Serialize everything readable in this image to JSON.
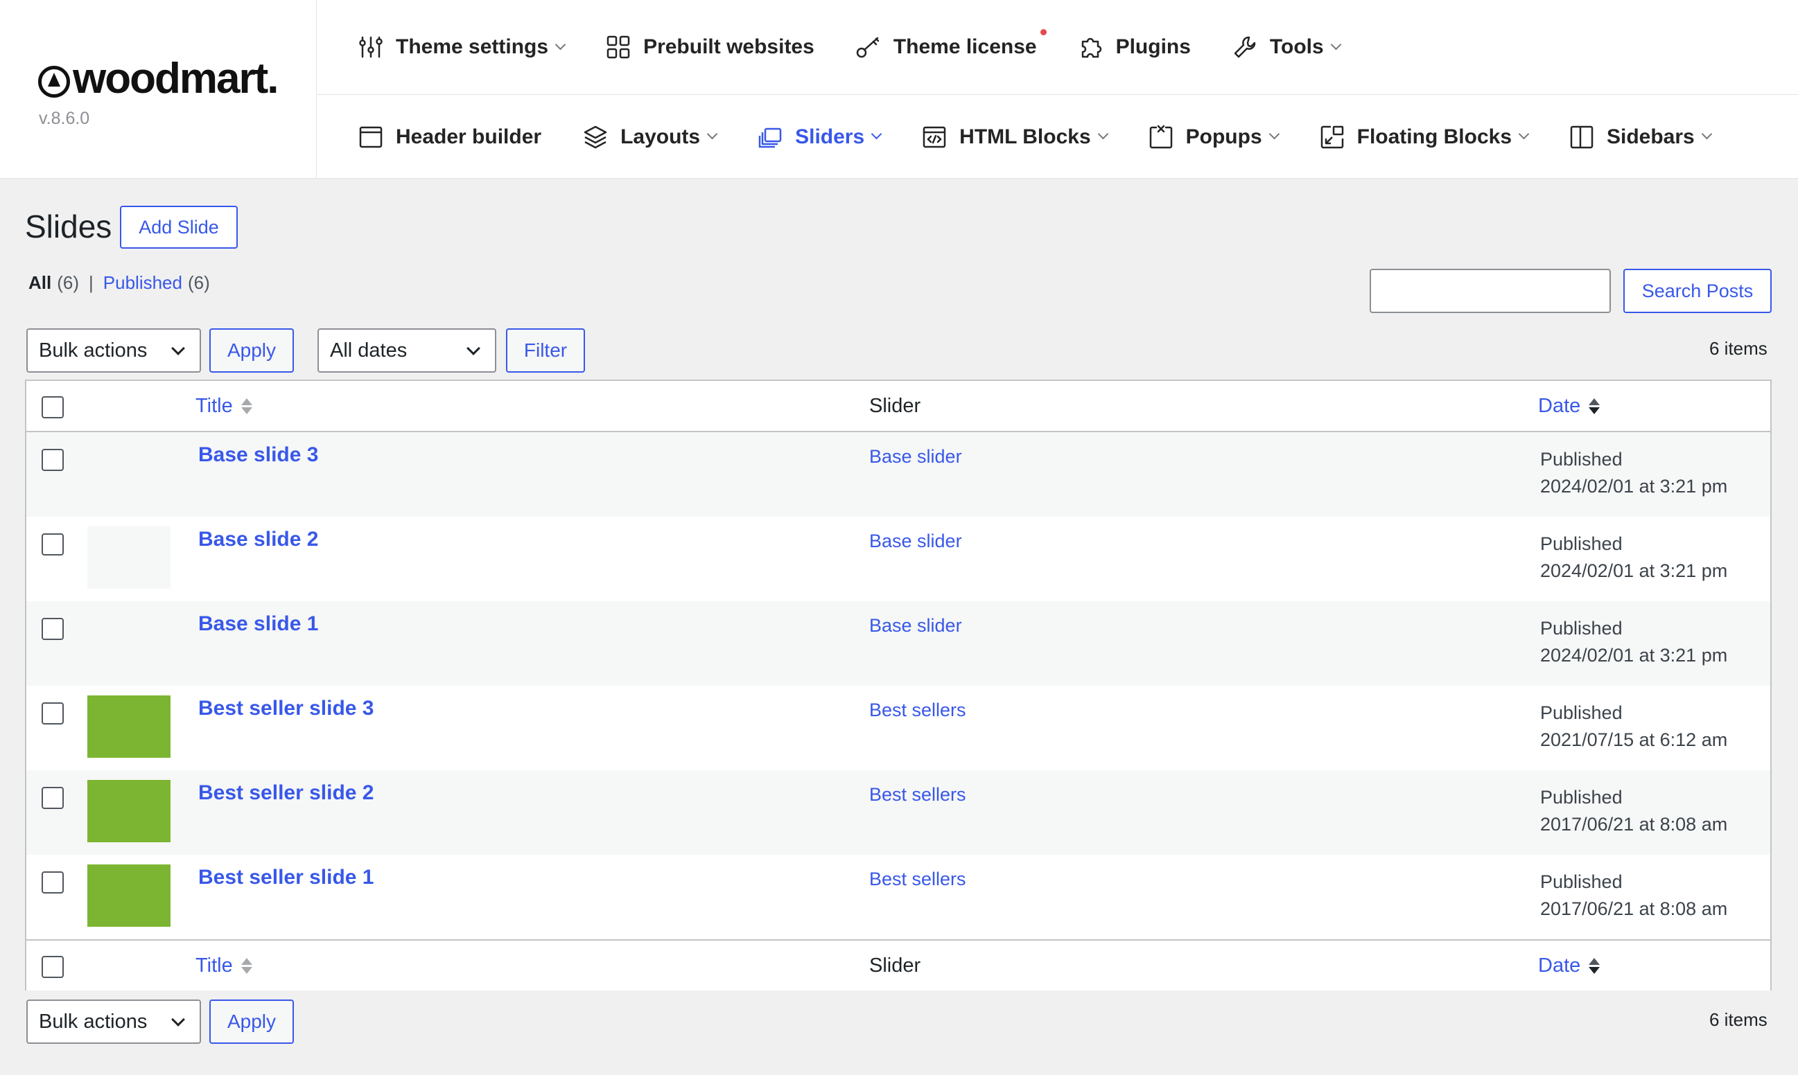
{
  "brand": {
    "logo_text": "woodmart.",
    "version": "v.8.6.0"
  },
  "nav_primary": [
    {
      "label": "Theme settings",
      "icon": "sliders-icon",
      "dropdown": true
    },
    {
      "label": "Prebuilt websites",
      "icon": "grid-icon",
      "dropdown": false
    },
    {
      "label": "Theme license",
      "icon": "key-icon",
      "dropdown": false,
      "notification": true
    },
    {
      "label": "Plugins",
      "icon": "puzzle-icon",
      "dropdown": false
    },
    {
      "label": "Tools",
      "icon": "wrench-icon",
      "dropdown": true
    }
  ],
  "nav_secondary": [
    {
      "label": "Header builder",
      "icon": "window-icon",
      "dropdown": false
    },
    {
      "label": "Layouts",
      "icon": "layers-icon",
      "dropdown": true
    },
    {
      "label": "Sliders",
      "icon": "slides-icon",
      "dropdown": true,
      "active": true
    },
    {
      "label": "HTML Blocks",
      "icon": "code-window-icon",
      "dropdown": true
    },
    {
      "label": "Popups",
      "icon": "popup-icon",
      "dropdown": true
    },
    {
      "label": "Floating Blocks",
      "icon": "floating-block-icon",
      "dropdown": true
    },
    {
      "label": "Sidebars",
      "icon": "sidebar-icon",
      "dropdown": true
    }
  ],
  "page": {
    "title": "Slides",
    "add_button": "Add Slide"
  },
  "filters_links": {
    "all_label": "All",
    "all_count": "(6)",
    "separator": "|",
    "published_label": "Published",
    "published_count": "(6)"
  },
  "search": {
    "button": "Search Posts",
    "value": ""
  },
  "toolbar_top": {
    "bulk_actions": "Bulk actions",
    "apply": "Apply",
    "dates": "All dates",
    "filter": "Filter",
    "items_count": "6 items"
  },
  "toolbar_bottom": {
    "bulk_actions": "Bulk actions",
    "apply": "Apply",
    "items_count": "6 items"
  },
  "columns": {
    "title": "Title",
    "slider": "Slider",
    "date": "Date"
  },
  "colors": {
    "accent": "#3858e9",
    "thumb_green": "#7cb532",
    "thumb_empty": "#f6f7f7"
  },
  "rows": [
    {
      "title": "Base slide 3",
      "slider": "Base slider",
      "status": "Published",
      "date": "2024/02/01 at 3:21 pm",
      "thumb": "none"
    },
    {
      "title": "Base slide 2",
      "slider": "Base slider",
      "status": "Published",
      "date": "2024/02/01 at 3:21 pm",
      "thumb": "light"
    },
    {
      "title": "Base slide 1",
      "slider": "Base slider",
      "status": "Published",
      "date": "2024/02/01 at 3:21 pm",
      "thumb": "none"
    },
    {
      "title": "Best seller slide 3",
      "slider": "Best sellers",
      "status": "Published",
      "date": "2021/07/15 at 6:12 am",
      "thumb": "green"
    },
    {
      "title": "Best seller slide 2",
      "slider": "Best sellers",
      "status": "Published",
      "date": "2017/06/21 at 8:08 am",
      "thumb": "green"
    },
    {
      "title": "Best seller slide 1",
      "slider": "Best sellers",
      "status": "Published",
      "date": "2017/06/21 at 8:08 am",
      "thumb": "green"
    }
  ]
}
